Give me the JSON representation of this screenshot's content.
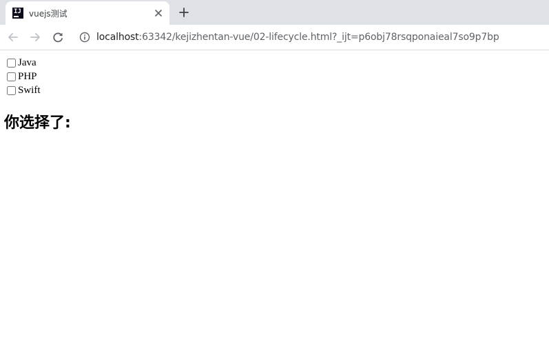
{
  "browser": {
    "tab": {
      "title": "vuejs测试",
      "favicon_text": "IJ"
    },
    "address": {
      "host": "localhost",
      "rest": ":63342/kejizhentan-vue/02-lifecycle.html?_ijt=p6obj78rsqponaieal7so9p7bp"
    },
    "icons": {
      "back": "arrow-left",
      "forward": "arrow-right",
      "reload": "reload",
      "info": "info-circle",
      "close": "close-x",
      "new_tab": "plus"
    }
  },
  "page": {
    "options": [
      {
        "label": "Java",
        "checked": false
      },
      {
        "label": "PHP",
        "checked": false
      },
      {
        "label": "Swift",
        "checked": false
      }
    ],
    "result_label": "你选择了:"
  },
  "colors": {
    "tabstrip": "#dee1e6",
    "active_tab": "#ffffff",
    "text_primary": "#202124",
    "text_secondary": "#5f6368"
  }
}
